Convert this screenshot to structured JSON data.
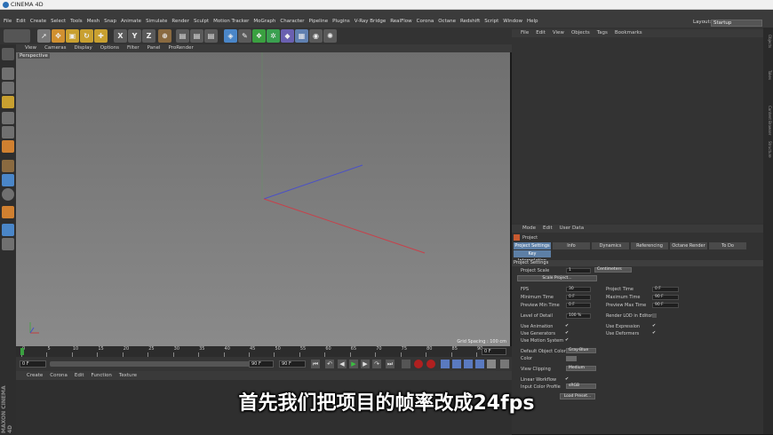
{
  "app": {
    "title": "CINEMA 4D"
  },
  "menu": {
    "items": [
      "File",
      "Edit",
      "Create",
      "Select",
      "Tools",
      "Mesh",
      "Snap",
      "Animate",
      "Simulate",
      "Render",
      "Sculpt",
      "Motion Tracker",
      "MoGraph",
      "Character",
      "Pipeline",
      "Plugins",
      "V-Ray Bridge",
      "RealFlow",
      "Corona",
      "Octane",
      "Redshift",
      "Script",
      "Window",
      "Help"
    ],
    "layout_label": "Layout:",
    "layout_value": "Startup"
  },
  "toolbar": {
    "axis_x": "X",
    "axis_y": "Y",
    "axis_z": "Z"
  },
  "viewport": {
    "menu": [
      "View",
      "Cameras",
      "Display",
      "Options",
      "Filter",
      "Panel",
      "ProRender"
    ],
    "camera_label": "Perspective",
    "grid_spacing": "Grid Spacing : 100 cm"
  },
  "timeline": {
    "ticks": [
      "0",
      "5",
      "10",
      "15",
      "20",
      "25",
      "30",
      "35",
      "40",
      "45",
      "50",
      "55",
      "60",
      "65",
      "70",
      "75",
      "80",
      "85",
      "90"
    ],
    "current_frame": "0 F"
  },
  "playbar": {
    "start": "0 F",
    "end_a": "90 F",
    "end_b": "90 F"
  },
  "material": {
    "menu": [
      "Create",
      "Corona",
      "Edit",
      "Function",
      "Texture"
    ]
  },
  "brand": {
    "maxon": "MAXON CINEMA 4D"
  },
  "objects": {
    "menu": [
      "File",
      "Edit",
      "View",
      "Objects",
      "Tags",
      "Bookmarks"
    ]
  },
  "right_tabs": [
    "Objects",
    "Takes",
    "Content Browser",
    "Structure"
  ],
  "attributes": {
    "menu": [
      "Mode",
      "Edit",
      "User Data"
    ],
    "header": "Project",
    "tabs": [
      "Project Settings",
      "Info",
      "Dynamics",
      "Referencing",
      "Octane Render",
      "To Do"
    ],
    "tab_row2": "Key Interpolation",
    "section": "Project Settings",
    "project_scale_label": "Project Scale",
    "project_scale_value": "1",
    "project_scale_unit": "Centimeters",
    "scale_project_btn": "Scale Project...",
    "fps_label": "FPS",
    "fps_value": "30",
    "project_time_label": "Project Time",
    "project_time_value": "0 F",
    "min_time_label": "Minimum Time",
    "min_time_value": "0 F",
    "max_time_label": "Maximum Time",
    "max_time_value": "90 F",
    "prev_min_label": "Preview Min Time",
    "prev_min_value": "0 F",
    "prev_max_label": "Preview Max Time",
    "prev_max_value": "90 F",
    "lod_label": "Level of Detail",
    "lod_value": "100 %",
    "render_lod_label": "Render LOD in Editor",
    "use_animation": "Use Animation",
    "use_expression": "Use Expression",
    "use_generators": "Use Generators",
    "use_deformers": "Use Deformers",
    "use_motion": "Use Motion System",
    "default_color_label": "Default Object Color",
    "default_color_value": "Gray-Blue",
    "color_label": "Color",
    "view_clipping_label": "View Clipping",
    "view_clipping_value": "Medium",
    "linear_workflow_label": "Linear Workflow",
    "input_color_label": "Input Color Profile",
    "input_color_value": "sRGB",
    "load_preset_btn": "Load Preset...",
    "check_mark": "✔"
  },
  "subtitle": "首先我们把项目的帧率改成24fps",
  "colors": {
    "accent": "#5d7fa6",
    "x_axis": "#c0404a",
    "y_axis": "#4a9b4a",
    "z_axis": "#5a6ad0"
  }
}
